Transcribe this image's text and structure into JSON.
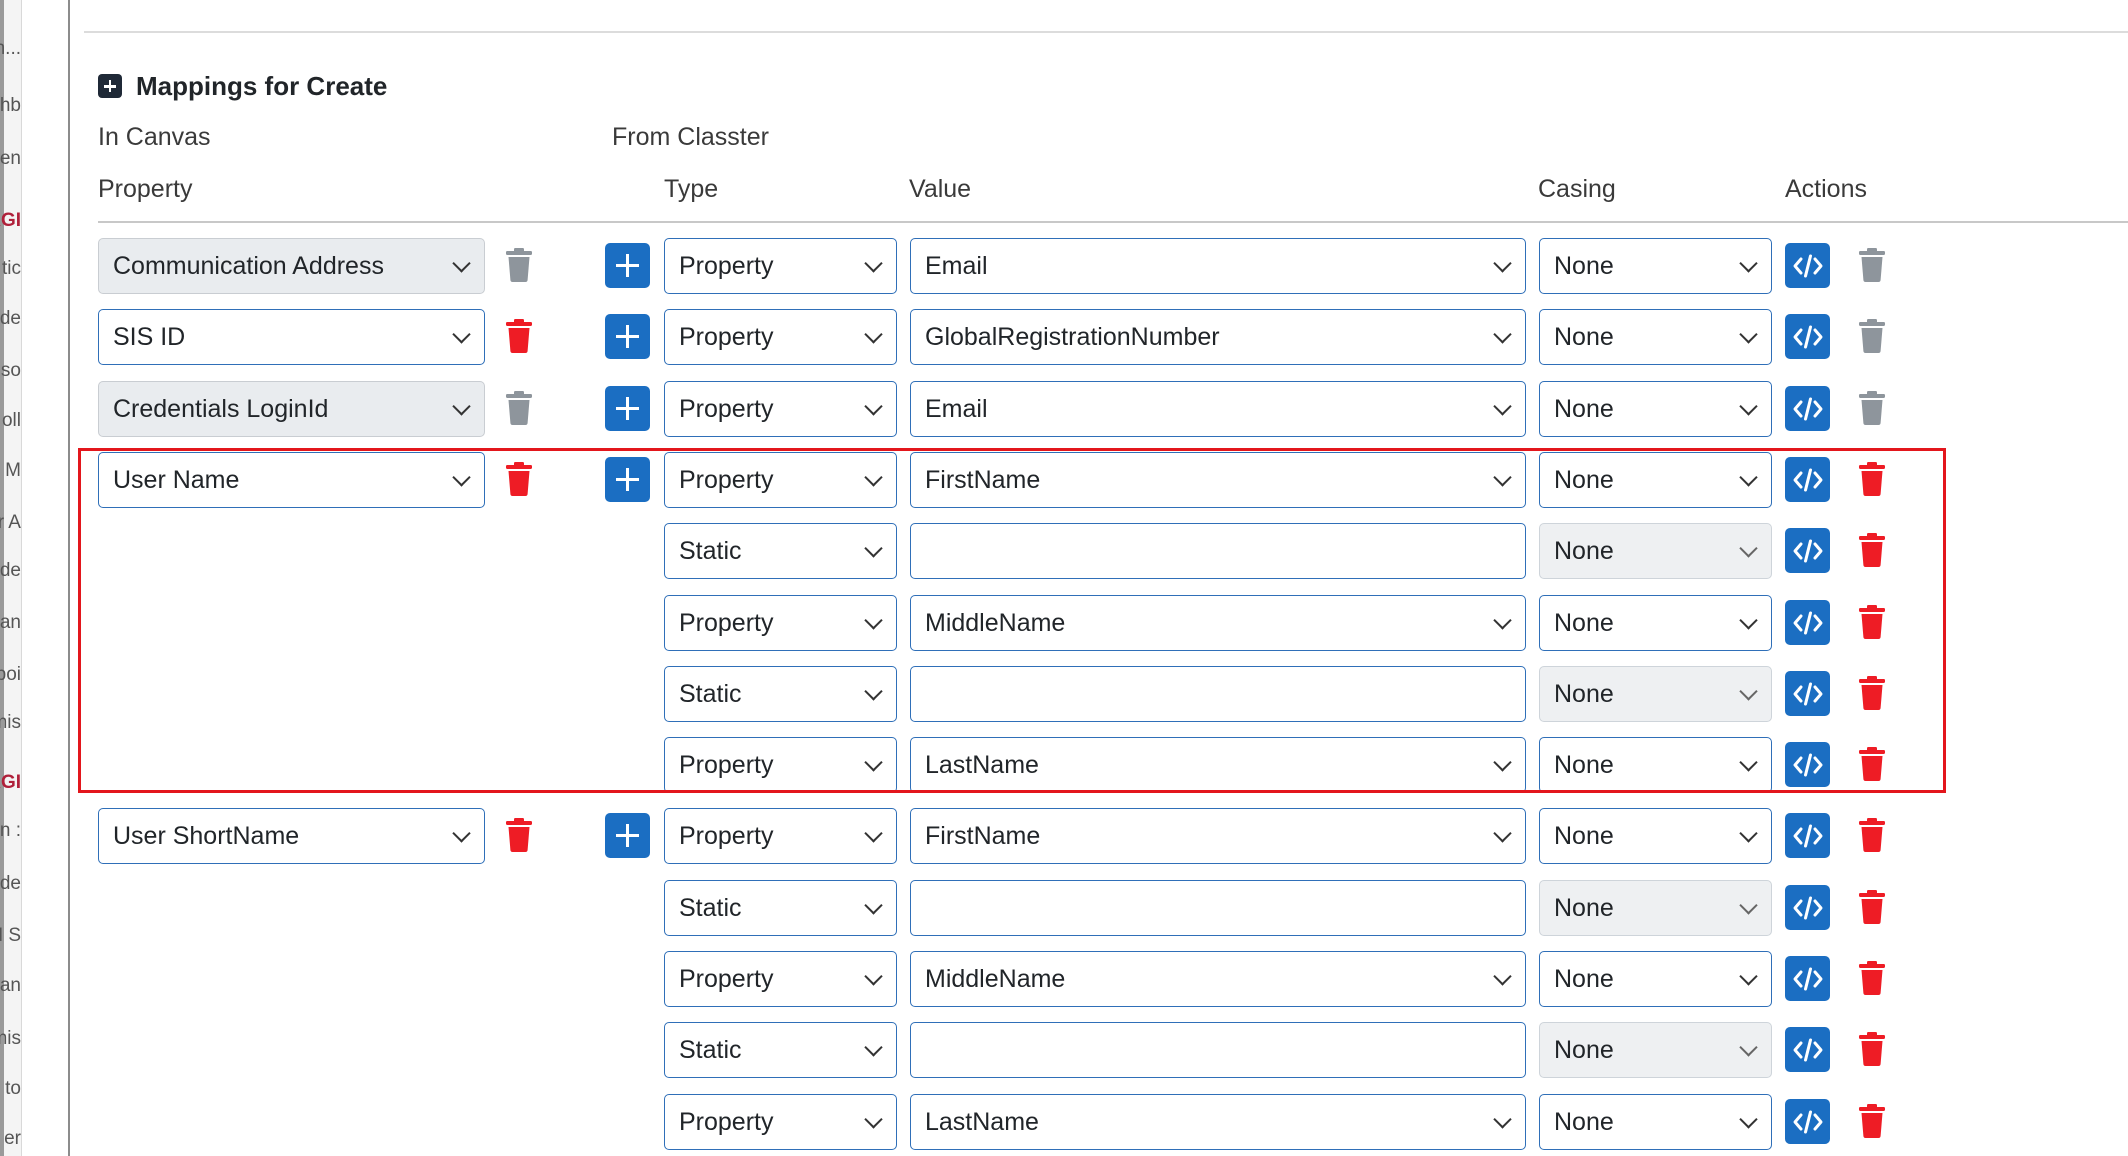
{
  "sidebar": {
    "fragments": [
      {
        "text": "n...",
        "red": false
      },
      {
        "text": "shb",
        "red": false
      },
      {
        "text": "en",
        "red": false
      },
      {
        "text": "AGI",
        "red": true
      },
      {
        "text": "tic",
        "red": false
      },
      {
        "text": "de",
        "red": false
      },
      {
        "text": "so",
        "red": false
      },
      {
        "text": "oll",
        "red": false
      },
      {
        "text": "M",
        "red": false
      },
      {
        "text": "er A",
        "red": false
      },
      {
        "text": "de",
        "red": false
      },
      {
        "text": "an",
        "red": false
      },
      {
        "text": "poi",
        "red": false
      },
      {
        "text": "mis",
        "red": false
      },
      {
        "text": "AGI",
        "red": true
      },
      {
        "text": "n :",
        "red": false
      },
      {
        "text": "de",
        "red": false
      },
      {
        "text": "M S",
        "red": false
      },
      {
        "text": "an",
        "red": false
      },
      {
        "text": "mis",
        "red": false
      },
      {
        "text": "to",
        "red": false
      },
      {
        "text": "er",
        "red": false
      }
    ]
  },
  "section": {
    "title": "Mappings for Create",
    "group_left": "In Canvas",
    "group_right": "From Classter",
    "col_property": "Property",
    "col_type": "Type",
    "col_value": "Value",
    "col_casing": "Casing",
    "col_actions": "Actions"
  },
  "mappings": [
    {
      "canvas": "Communication Address",
      "canvas_style": "grey",
      "canvas_trash": "grey",
      "rows": [
        {
          "type": "Property",
          "value": "Email",
          "casing": "None",
          "casing_disabled": false,
          "trash": "grey"
        }
      ]
    },
    {
      "canvas": "SIS ID",
      "canvas_style": "blue",
      "canvas_trash": "red",
      "rows": [
        {
          "type": "Property",
          "value": "GlobalRegistrationNumber",
          "casing": "None",
          "casing_disabled": false,
          "trash": "grey"
        }
      ]
    },
    {
      "canvas": "Credentials LoginId",
      "canvas_style": "grey",
      "canvas_trash": "grey",
      "rows": [
        {
          "type": "Property",
          "value": "Email",
          "casing": "None",
          "casing_disabled": false,
          "trash": "grey"
        }
      ]
    },
    {
      "canvas": "User Name",
      "canvas_style": "blue",
      "canvas_trash": "red",
      "highlighted": true,
      "rows": [
        {
          "type": "Property",
          "value": "FirstName",
          "casing": "None",
          "casing_disabled": false,
          "trash": "red"
        },
        {
          "type": "Static",
          "value": "",
          "casing": "None",
          "casing_disabled": true,
          "trash": "red"
        },
        {
          "type": "Property",
          "value": "MiddleName",
          "casing": "None",
          "casing_disabled": false,
          "trash": "red"
        },
        {
          "type": "Static",
          "value": "",
          "casing": "None",
          "casing_disabled": true,
          "trash": "red"
        },
        {
          "type": "Property",
          "value": "LastName",
          "casing": "None",
          "casing_disabled": false,
          "trash": "red"
        }
      ]
    },
    {
      "canvas": "User ShortName",
      "canvas_style": "blue",
      "canvas_trash": "red",
      "rows": [
        {
          "type": "Property",
          "value": "FirstName",
          "casing": "None",
          "casing_disabled": false,
          "trash": "red"
        },
        {
          "type": "Static",
          "value": "",
          "casing": "None",
          "casing_disabled": true,
          "trash": "red"
        },
        {
          "type": "Property",
          "value": "MiddleName",
          "casing": "None",
          "casing_disabled": false,
          "trash": "red"
        },
        {
          "type": "Static",
          "value": "",
          "casing": "None",
          "casing_disabled": true,
          "trash": "red"
        },
        {
          "type": "Property",
          "value": "LastName",
          "casing": "None",
          "casing_disabled": false,
          "trash": "red"
        }
      ]
    }
  ],
  "colors": {
    "primary": "#1b6ec2",
    "danger": "#ee1c25",
    "muted": "#8e959c",
    "highlight": "#e3161c"
  }
}
